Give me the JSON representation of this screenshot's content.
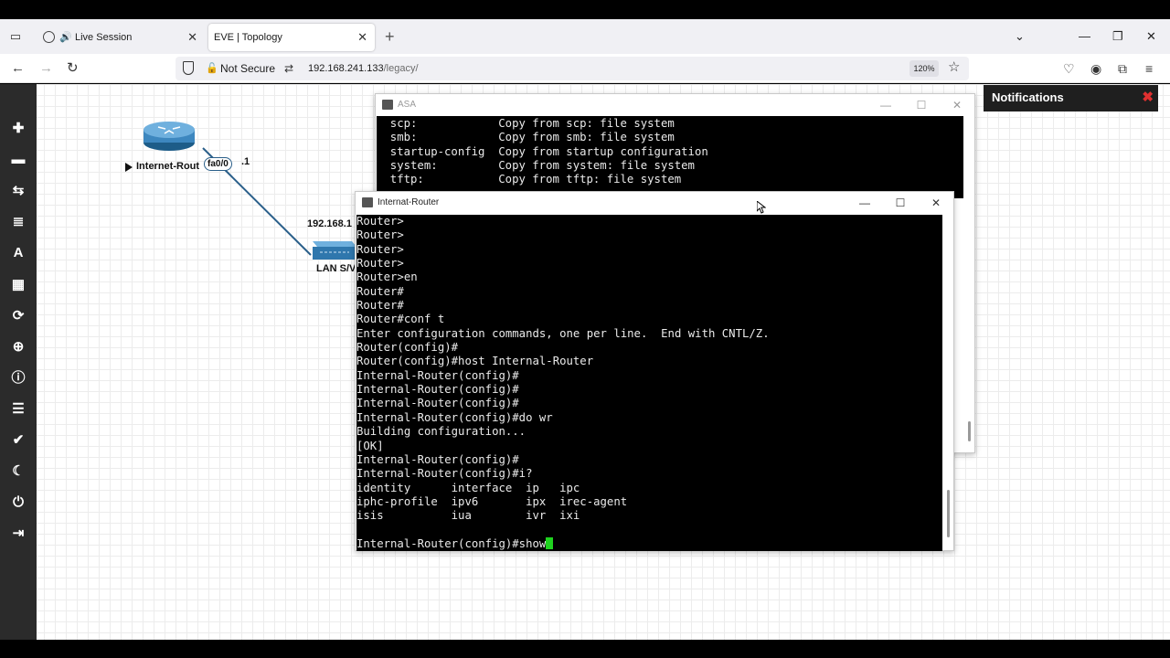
{
  "browser": {
    "tabs": [
      {
        "label": "Live Session",
        "active": false
      },
      {
        "label": "EVE | Topology",
        "active": true
      }
    ],
    "url": {
      "security": "Not Secure",
      "host": "192.168.241.133",
      "path": "/legacy/"
    },
    "zoom": "120%"
  },
  "sidebar": {
    "icons": [
      "add-icon",
      "node-list-icon",
      "network-icon",
      "startup-config-icon",
      "text-icon",
      "apps-icon",
      "refresh-icon",
      "zoom-icon",
      "info-icon",
      "logs-icon",
      "lab-status-icon",
      "dark-mode-icon",
      "power-icon",
      "logout-icon"
    ]
  },
  "topology": {
    "router_label": "Internet-Rout",
    "router_interface": "fa0/0",
    "router_ip_suffix": ".1",
    "switch_ip_label": "192.168.1",
    "switch_label": "LAN S/V"
  },
  "notifications": {
    "title": "Notifications"
  },
  "asa_window": {
    "title": "ASA",
    "lines": [
      "  scp:            Copy from scp: file system",
      "  smb:            Copy from smb: file system",
      "  startup-config  Copy from startup configuration",
      "  system:         Copy from system: file system",
      "  tftp:           Copy from tftp: file system"
    ]
  },
  "router_window": {
    "title": "Internat-Router",
    "lines": [
      "Router>",
      "Router>",
      "Router>",
      "Router>",
      "Router>en",
      "Router#",
      "Router#",
      "Router#conf t",
      "Enter configuration commands, one per line.  End with CNTL/Z.",
      "Router(config)#",
      "Router(config)#host Internal-Router",
      "Internal-Router(config)#",
      "Internal-Router(config)#",
      "Internal-Router(config)#",
      "Internal-Router(config)#do wr",
      "Building configuration...",
      "[OK]",
      "Internal-Router(config)#",
      "Internal-Router(config)#i?",
      "identity      interface  ip   ipc",
      "iphc-profile  ipv6       ipx  irec-agent",
      "isis          iua        ivr  ixi",
      ""
    ],
    "prompt_line": "Internal-Router(config)#show"
  },
  "colors": {
    "cursor": "#1fd21f",
    "terminal_bg": "#000000",
    "link": "#2a5f8a"
  }
}
